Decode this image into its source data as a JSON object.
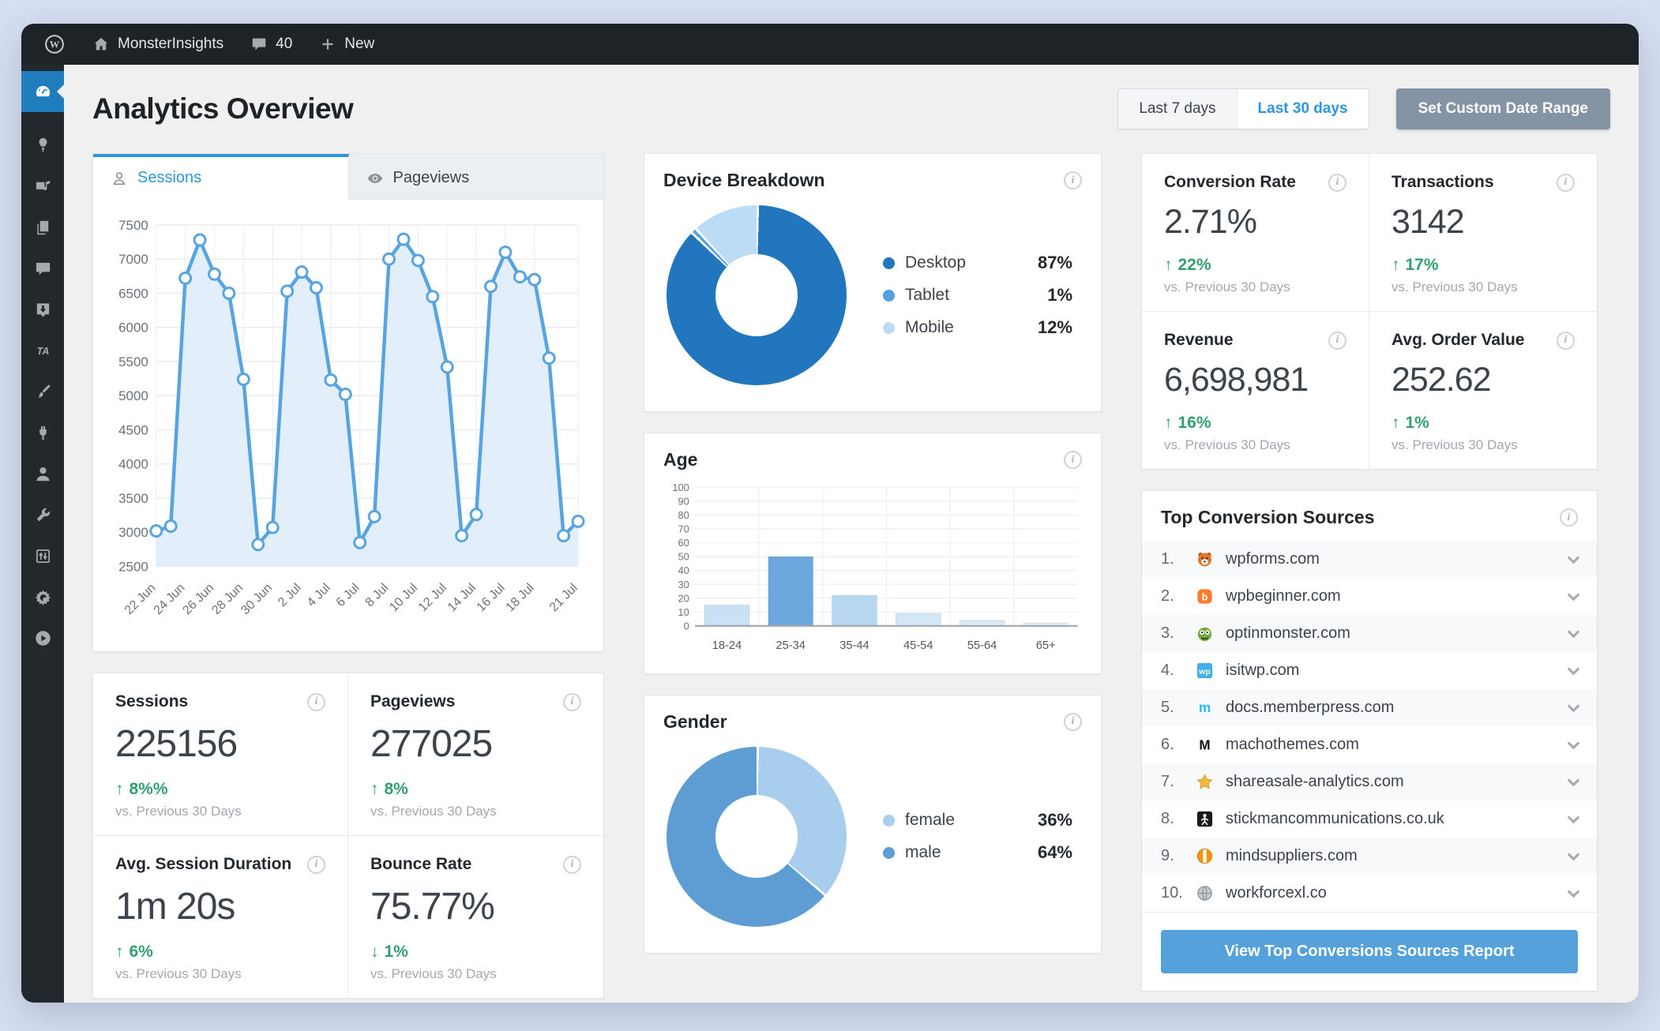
{
  "colors": {
    "accent_blue": "#2d95dd",
    "button_blue": "#55a1dc",
    "active_menu_blue": "#1f7dbd",
    "green_positive": "#2fa06e",
    "custom_range_gray": "#8494a5",
    "admin_bar_bg": "#1d2327",
    "sidebar_bg": "#23282d"
  },
  "admin_bar": {
    "site_name": "MonsterInsights",
    "comment_count": "40",
    "new_label": "New"
  },
  "sidebar": {
    "items": [
      {
        "name": "dashboard",
        "icon": "gauge-icon",
        "active": true
      },
      {
        "name": "posts",
        "icon": "pin-icon"
      },
      {
        "name": "media",
        "icon": "media-icon"
      },
      {
        "name": "pages",
        "icon": "pages-icon"
      },
      {
        "name": "comments",
        "icon": "comments-icon"
      },
      {
        "name": "downloads",
        "icon": "download-icon"
      },
      {
        "name": "ta",
        "icon": "ta-icon"
      },
      {
        "name": "appearance",
        "icon": "brush-icon"
      },
      {
        "name": "plugins",
        "icon": "plug-icon"
      },
      {
        "name": "users",
        "icon": "user-icon"
      },
      {
        "name": "tools",
        "icon": "wrench-icon"
      },
      {
        "name": "settings",
        "icon": "sliders-icon"
      },
      {
        "name": "seedprod",
        "icon": "burst-icon"
      },
      {
        "name": "video",
        "icon": "play-icon"
      }
    ]
  },
  "header": {
    "title": "Analytics Overview",
    "last7": "Last 7 days",
    "last30": "Last 30 days",
    "custom_range": "Set Custom Date Range"
  },
  "tabs": {
    "sessions": "Sessions",
    "pageviews": "Pageviews"
  },
  "chart_data": [
    {
      "type": "line",
      "title": "Sessions",
      "x": [
        "22 Jun",
        "23 Jun",
        "24 Jun",
        "25 Jun",
        "26 Jun",
        "27 Jun",
        "28 Jun",
        "29 Jun",
        "30 Jun",
        "1 Jul",
        "2 Jul",
        "3 Jul",
        "4 Jul",
        "5 Jul",
        "6 Jul",
        "7 Jul",
        "8 Jul",
        "9 Jul",
        "10 Jul",
        "11 Jul",
        "12 Jul",
        "13 Jul",
        "14 Jul",
        "15 Jul",
        "16 Jul",
        "17 Jul",
        "18 Jul",
        "19 Jul",
        "20 Jul",
        "21 Jul"
      ],
      "values": [
        3020,
        3090,
        6720,
        7280,
        6780,
        6500,
        5240,
        2820,
        3070,
        6530,
        6810,
        6580,
        5230,
        5020,
        2850,
        3230,
        7000,
        7290,
        6980,
        6450,
        5420,
        2950,
        3260,
        6600,
        7100,
        6740,
        6700,
        5550,
        2950,
        3160
      ],
      "x_tick_labels": [
        "22 Jun",
        "24 Jun",
        "26 Jun",
        "28 Jun",
        "30 Jun",
        "2 Jul",
        "4 Jul",
        "6 Jul",
        "8 Jul",
        "10 Jul",
        "12 Jul",
        "14 Jul",
        "16 Jul",
        "18 Jul",
        "21 Jul"
      ],
      "ylim": [
        2500,
        7500
      ],
      "y_ticks": [
        2500,
        3000,
        3500,
        4000,
        4500,
        5000,
        5500,
        6000,
        6500,
        7000,
        7500
      ],
      "grid": true,
      "legend_position": "none",
      "line_color": "#57a4e1",
      "fill_color": "#e2eefa"
    },
    {
      "type": "pie",
      "title": "Device Breakdown",
      "labels": [
        "Desktop",
        "Tablet",
        "Mobile"
      ],
      "values": [
        87,
        1,
        12
      ],
      "value_labels": [
        "87%",
        "1%",
        "12%"
      ],
      "colors": [
        "#2176bd",
        "#55a1e0",
        "#bcdcf6"
      ],
      "legend_position": "right",
      "donut": true
    },
    {
      "type": "bar",
      "title": "Age",
      "categories": [
        "18-24",
        "25-34",
        "35-44",
        "45-54",
        "55-64",
        "65+"
      ],
      "values": [
        15,
        50,
        22,
        9,
        4,
        2
      ],
      "colors": [
        "#c9e0f5",
        "#6ba7dc",
        "#b7d7f1",
        "#d3e6f7",
        "#ddebf9",
        "#e7f1fb"
      ],
      "xlabel": "",
      "ylabel": "",
      "ylim": [
        0,
        100
      ],
      "y_ticks": [
        0,
        10,
        20,
        30,
        40,
        50,
        60,
        70,
        80,
        90,
        100
      ],
      "grid": true
    },
    {
      "type": "pie",
      "title": "Gender",
      "labels": [
        "female",
        "male"
      ],
      "values": [
        36,
        64
      ],
      "value_labels": [
        "36%",
        "64%"
      ],
      "colors": [
        "#a9cdec",
        "#5e9cd4"
      ],
      "legend_position": "right",
      "donut": true
    }
  ],
  "stats_left": [
    {
      "label": "Sessions",
      "value": "225156",
      "delta": "8%%",
      "direction": "up",
      "compare": "vs. Previous 30 Days"
    },
    {
      "label": "Pageviews",
      "value": "277025",
      "delta": "8%",
      "direction": "up",
      "compare": "vs. Previous 30 Days"
    },
    {
      "label": "Avg. Session Duration",
      "value": "1m 20s",
      "delta": "6%",
      "direction": "up",
      "compare": "vs. Previous 30 Days"
    },
    {
      "label": "Bounce Rate",
      "value": "75.77%",
      "delta": "1%",
      "direction": "down",
      "compare": "vs. Previous 30 Days"
    }
  ],
  "stats_right": [
    {
      "label": "Conversion Rate",
      "value": "2.71%",
      "delta": "22%",
      "direction": "up",
      "compare": "vs. Previous 30 Days"
    },
    {
      "label": "Transactions",
      "value": "3142",
      "delta": "17%",
      "direction": "up",
      "compare": "vs. Previous 30 Days"
    },
    {
      "label": "Revenue",
      "value": "6,698,981",
      "delta": "16%",
      "direction": "up",
      "compare": "vs. Previous 30 Days"
    },
    {
      "label": "Avg. Order Value",
      "value": "252.62",
      "delta": "1%",
      "direction": "up",
      "compare": "vs. Previous 30 Days"
    }
  ],
  "sources": {
    "title": "Top Conversion Sources",
    "items": [
      {
        "rank": "1.",
        "domain": "wpforms.com",
        "icon": "wpforms-favicon"
      },
      {
        "rank": "2.",
        "domain": "wpbeginner.com",
        "icon": "wpbeginner-favicon"
      },
      {
        "rank": "3.",
        "domain": "optinmonster.com",
        "icon": "optinmonster-favicon"
      },
      {
        "rank": "4.",
        "domain": "isitwp.com",
        "icon": "isitwp-favicon"
      },
      {
        "rank": "5.",
        "domain": "docs.memberpress.com",
        "icon": "memberpress-favicon"
      },
      {
        "rank": "6.",
        "domain": "machothemes.com",
        "icon": "machothemes-favicon"
      },
      {
        "rank": "7.",
        "domain": "shareasale-analytics.com",
        "icon": "star-favicon"
      },
      {
        "rank": "8.",
        "domain": "stickmancommunications.co.uk",
        "icon": "stickman-favicon"
      },
      {
        "rank": "9.",
        "domain": "mindsuppliers.com",
        "icon": "mindsuppliers-favicon"
      },
      {
        "rank": "10.",
        "domain": "workforcexl.co",
        "icon": "globe-favicon"
      }
    ],
    "button_label": "View Top Conversions Sources Report"
  }
}
